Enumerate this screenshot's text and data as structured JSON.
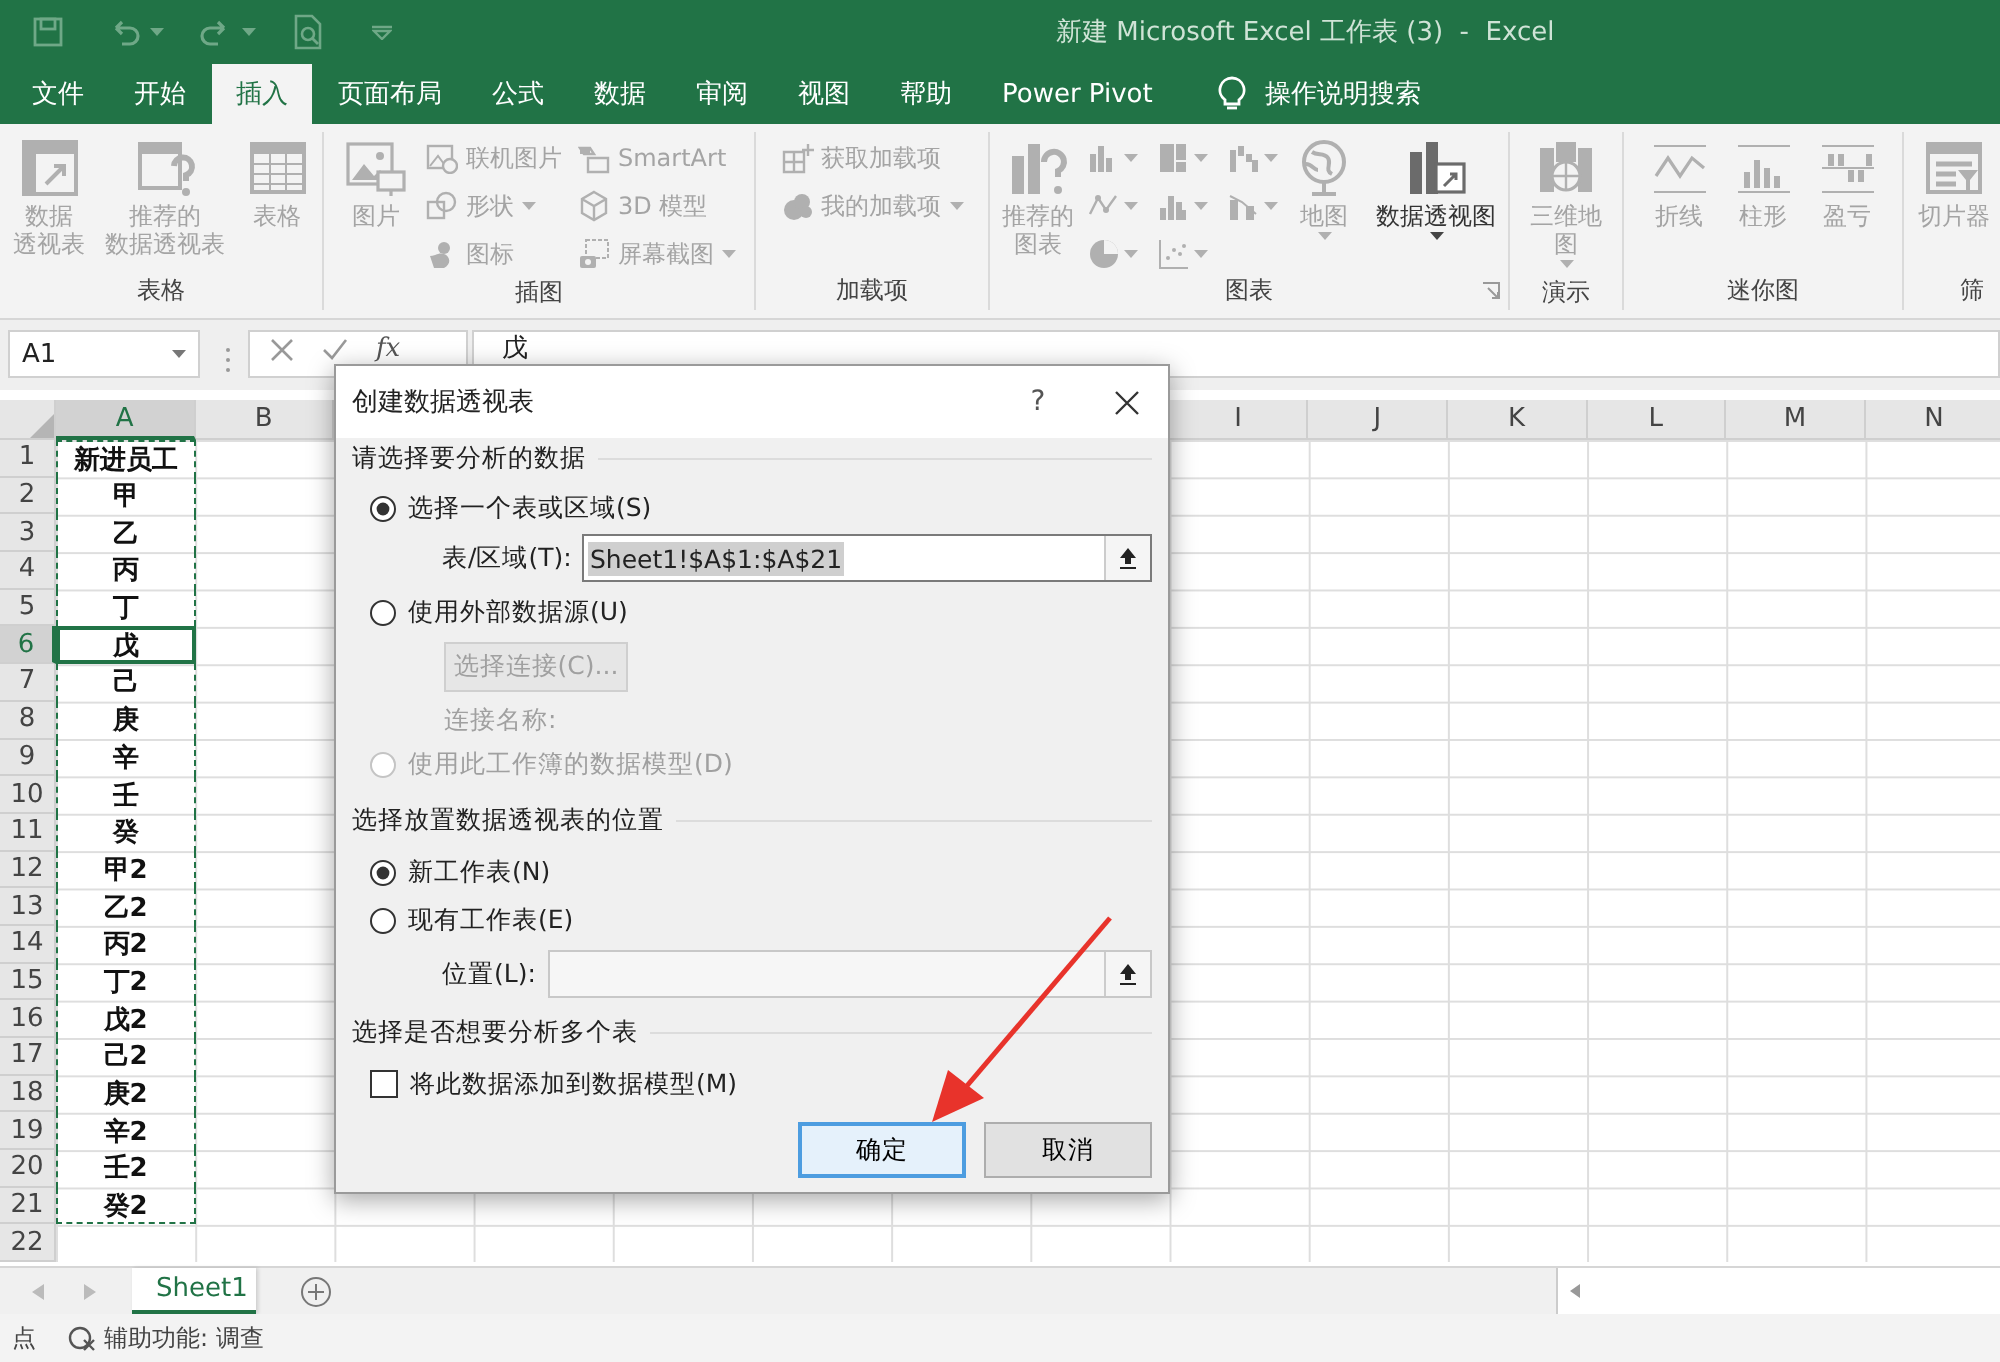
{
  "title_bar": {
    "title": "新建 Microsoft Excel 工作表 (3)  -  Excel"
  },
  "ribbon_tabs": [
    {
      "label": "文件",
      "selected": false
    },
    {
      "label": "开始",
      "selected": false
    },
    {
      "label": "插入",
      "selected": true
    },
    {
      "label": "页面布局",
      "selected": false
    },
    {
      "label": "公式",
      "selected": false
    },
    {
      "label": "数据",
      "selected": false
    },
    {
      "label": "审阅",
      "selected": false
    },
    {
      "label": "视图",
      "selected": false
    },
    {
      "label": "帮助",
      "selected": false
    },
    {
      "label": "Power Pivot",
      "selected": false
    }
  ],
  "tell_me": {
    "label": "操作说明搜索"
  },
  "ribbon_groups": [
    {
      "label": "表格",
      "launcher": false,
      "items": [
        {
          "kind": "large",
          "lines": [
            "数据",
            "透视表"
          ],
          "disabled": true,
          "dropdown": false
        },
        {
          "kind": "large",
          "lines": [
            "推荐的",
            "数据透视表"
          ],
          "disabled": true,
          "dropdown": false
        },
        {
          "kind": "large",
          "label": "表格",
          "disabled": true,
          "dropdown": false
        }
      ]
    },
    {
      "label": "插图",
      "launcher": false,
      "items": [
        {
          "kind": "large",
          "label": "图片",
          "disabled": true,
          "dropdown": false
        },
        {
          "kind": "stack",
          "items": [
            {
              "label": "联机图片",
              "disabled": true,
              "dropdown": false
            },
            {
              "label": "形状",
              "disabled": true,
              "dropdown": true
            },
            {
              "label": "图标",
              "disabled": true,
              "dropdown": false
            }
          ]
        },
        {
          "kind": "stack",
          "items": [
            {
              "label": "SmartArt",
              "disabled": true,
              "dropdown": false
            },
            {
              "label": "3D 模型",
              "disabled": true,
              "dropdown": false
            },
            {
              "label": "屏幕截图",
              "disabled": true,
              "dropdown": true
            }
          ]
        }
      ]
    },
    {
      "label": "加载项",
      "launcher": false,
      "items": [
        {
          "kind": "stack",
          "items": [
            {
              "label": "获取加载项",
              "disabled": true,
              "dropdown": false
            },
            {
              "label": "我的加载项",
              "disabled": true,
              "dropdown": true
            }
          ]
        }
      ]
    },
    {
      "label": "图表",
      "launcher": true,
      "items": [
        {
          "kind": "large",
          "lines": [
            "推荐的",
            "图表"
          ],
          "disabled": true,
          "dropdown": false
        },
        {
          "kind": "gallery",
          "disabled": true
        },
        {
          "kind": "large",
          "label": "地图",
          "disabled": true,
          "dropdown": true
        },
        {
          "kind": "large",
          "label": "数据透视图",
          "disabled": false,
          "dropdown": true
        }
      ]
    },
    {
      "label": "演示",
      "launcher": false,
      "items": [
        {
          "kind": "large",
          "lines": [
            "三维地",
            "图"
          ],
          "disabled": true,
          "dropdown": true
        }
      ]
    },
    {
      "label": "迷你图",
      "launcher": false,
      "items": [
        {
          "kind": "large",
          "label": "折线",
          "disabled": true,
          "dropdown": false
        },
        {
          "kind": "large",
          "label": "柱形",
          "disabled": true,
          "dropdown": false
        },
        {
          "kind": "large",
          "label": "盈亏",
          "disabled": true,
          "dropdown": false
        }
      ]
    },
    {
      "label": "筛",
      "launcher": false,
      "items": [
        {
          "kind": "large",
          "label": "切片器",
          "disabled": true,
          "dropdown": false
        }
      ]
    }
  ],
  "formula_bar": {
    "name_box": "A1",
    "function_label": "fx",
    "content": "戊"
  },
  "grid": {
    "columns": [
      {
        "kind": "header",
        "label": "A",
        "selected": true
      },
      {
        "kind": "header",
        "label": "B",
        "selected": false
      },
      {
        "kind": "covered"
      },
      {
        "kind": "covered"
      },
      {
        "kind": "covered"
      },
      {
        "kind": "covered"
      },
      {
        "kind": "covered"
      },
      {
        "kind": "covered"
      },
      {
        "kind": "header",
        "label": "I",
        "selected": false
      },
      {
        "kind": "header",
        "label": "J",
        "selected": false
      },
      {
        "kind": "header",
        "label": "K",
        "selected": false
      },
      {
        "kind": "header",
        "label": "L",
        "selected": false
      },
      {
        "kind": "header",
        "label": "M",
        "selected": false
      },
      {
        "kind": "header",
        "label": "N",
        "selected": false
      }
    ],
    "rows": [
      {
        "number": "1",
        "selected": false,
        "marquee": true,
        "cells": [
          "新进员工"
        ]
      },
      {
        "number": "2",
        "selected": false,
        "marquee": true,
        "cells": [
          "甲"
        ]
      },
      {
        "number": "3",
        "selected": false,
        "marquee": true,
        "cells": [
          "乙"
        ]
      },
      {
        "number": "4",
        "selected": false,
        "marquee": true,
        "cells": [
          "丙"
        ]
      },
      {
        "number": "5",
        "selected": false,
        "marquee": true,
        "cells": [
          "丁"
        ]
      },
      {
        "number": "6",
        "selected": true,
        "marquee": true,
        "cells": [
          "戊"
        ]
      },
      {
        "number": "7",
        "selected": false,
        "marquee": true,
        "cells": [
          "己"
        ]
      },
      {
        "number": "8",
        "selected": false,
        "marquee": true,
        "cells": [
          "庚"
        ]
      },
      {
        "number": "9",
        "selected": false,
        "marquee": true,
        "cells": [
          "辛"
        ]
      },
      {
        "number": "10",
        "selected": false,
        "marquee": true,
        "cells": [
          "壬"
        ]
      },
      {
        "number": "11",
        "selected": false,
        "marquee": true,
        "cells": [
          "癸"
        ]
      },
      {
        "number": "12",
        "selected": false,
        "marquee": true,
        "cells": [
          "甲2"
        ]
      },
      {
        "number": "13",
        "selected": false,
        "marquee": true,
        "cells": [
          "乙2"
        ]
      },
      {
        "number": "14",
        "selected": false,
        "marquee": true,
        "cells": [
          "丙2"
        ]
      },
      {
        "number": "15",
        "selected": false,
        "marquee": true,
        "cells": [
          "丁2"
        ]
      },
      {
        "number": "16",
        "selected": false,
        "marquee": true,
        "cells": [
          "戊2"
        ]
      },
      {
        "number": "17",
        "selected": false,
        "marquee": true,
        "cells": [
          "己2"
        ]
      },
      {
        "number": "18",
        "selected": false,
        "marquee": true,
        "cells": [
          "庚2"
        ]
      },
      {
        "number": "19",
        "selected": false,
        "marquee": true,
        "cells": [
          "辛2"
        ]
      },
      {
        "number": "20",
        "selected": false,
        "marquee": true,
        "cells": [
          "壬2"
        ]
      },
      {
        "number": "21",
        "selected": false,
        "marquee": true,
        "cells": [
          "癸2"
        ]
      },
      {
        "number": "22",
        "selected": false,
        "marquee": false
      }
    ]
  },
  "sheet_tabs": [
    {
      "label": "Sheet1",
      "selected": true
    }
  ],
  "status_bar": {
    "mode": "点",
    "accessibility": "辅助功能: 调查"
  },
  "dialog": {
    "title": "创建数据透视表",
    "help": "?",
    "source_heading": "请选择要分析的数据",
    "source_options": [
      {
        "label": "选择一个表或区域(S)",
        "selected": true,
        "disabled": false
      },
      {
        "label": "使用外部数据源(U)",
        "selected": false,
        "disabled": false
      },
      {
        "label": "使用此工作簿的数据模型(D)",
        "selected": false,
        "disabled": true
      }
    ],
    "range_field": {
      "label": "表/区域(T):",
      "value": "Sheet1!$A$1:$A$21",
      "highlighted": true,
      "disabled": false
    },
    "connection_button": {
      "label": "选择连接(C)...",
      "disabled": true
    },
    "connection_name": {
      "label": "连接名称:",
      "disabled": true
    },
    "location_heading": "选择放置数据透视表的位置",
    "location_options": [
      {
        "label": "新工作表(N)",
        "selected": true,
        "disabled": false
      },
      {
        "label": "现有工作表(E)",
        "selected": false,
        "disabled": false
      }
    ],
    "location_field": {
      "label": "位置(L):",
      "disabled": true
    },
    "multi_heading": "选择是否想要分析多个表",
    "data_model_checkbox": {
      "label": "将此数据添加到数据模型(M)",
      "checked": false
    },
    "buttons": [
      {
        "label": "确定",
        "default": true
      },
      {
        "label": "取消",
        "default": false
      }
    ]
  }
}
